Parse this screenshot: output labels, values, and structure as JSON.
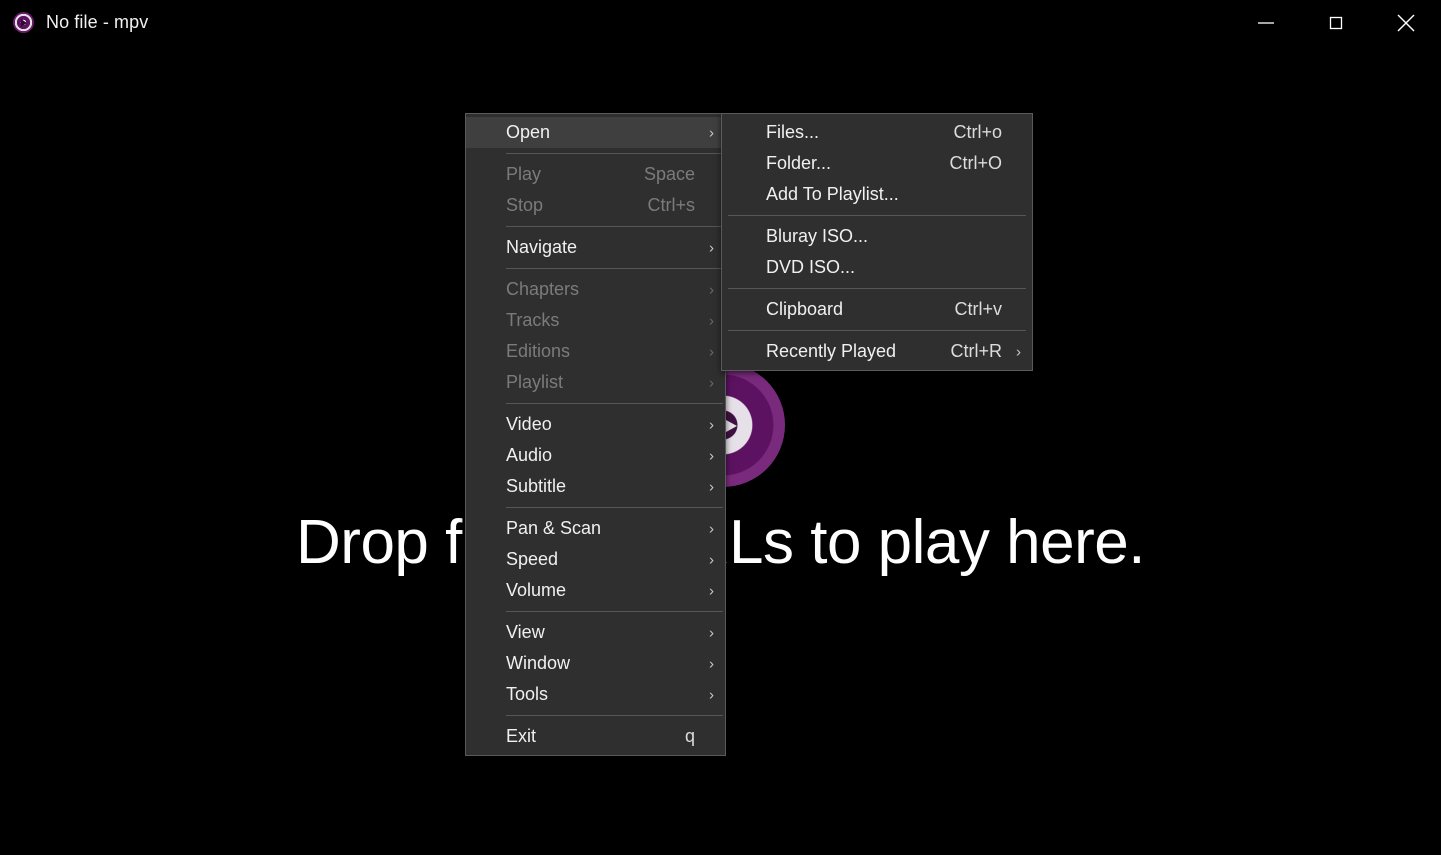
{
  "window": {
    "title": "No file - mpv",
    "icon": "mpv-logo-icon",
    "controls": {
      "minimize": "minimize-button",
      "maximize": "maximize-button",
      "close": "close-button"
    }
  },
  "splash": {
    "text": "Drop files or URLs to play here.",
    "logo": "mpv-logo"
  },
  "colors": {
    "window_background": "#000000",
    "menu_background": "#2f2f2f",
    "menu_border": "#5a5a5a",
    "menu_highlight": "#3f3f3f",
    "menu_text": "#f0f0f0",
    "menu_text_disabled": "#7b7b7b",
    "separator": "#565656",
    "logo_purple": "#6d1f70"
  },
  "context_menu": {
    "name": "mpv-context-menu",
    "items": [
      {
        "label": "Open",
        "accel": "",
        "arrow": true,
        "disabled": false,
        "highlight": true,
        "sep_after": true
      },
      {
        "label": "Play",
        "accel": "Space",
        "arrow": false,
        "disabled": true,
        "highlight": false,
        "sep_after": false
      },
      {
        "label": "Stop",
        "accel": "Ctrl+s",
        "arrow": false,
        "disabled": true,
        "highlight": false,
        "sep_after": true
      },
      {
        "label": "Navigate",
        "accel": "",
        "arrow": true,
        "disabled": false,
        "highlight": false,
        "sep_after": true
      },
      {
        "label": "Chapters",
        "accel": "",
        "arrow": true,
        "disabled": true,
        "highlight": false,
        "sep_after": false
      },
      {
        "label": "Tracks",
        "accel": "",
        "arrow": true,
        "disabled": true,
        "highlight": false,
        "sep_after": false
      },
      {
        "label": "Editions",
        "accel": "",
        "arrow": true,
        "disabled": true,
        "highlight": false,
        "sep_after": false
      },
      {
        "label": "Playlist",
        "accel": "",
        "arrow": true,
        "disabled": true,
        "highlight": false,
        "sep_after": true
      },
      {
        "label": "Video",
        "accel": "",
        "arrow": true,
        "disabled": false,
        "highlight": false,
        "sep_after": false
      },
      {
        "label": "Audio",
        "accel": "",
        "arrow": true,
        "disabled": false,
        "highlight": false,
        "sep_after": false
      },
      {
        "label": "Subtitle",
        "accel": "",
        "arrow": true,
        "disabled": false,
        "highlight": false,
        "sep_after": true
      },
      {
        "label": "Pan & Scan",
        "accel": "",
        "arrow": true,
        "disabled": false,
        "highlight": false,
        "sep_after": false
      },
      {
        "label": "Speed",
        "accel": "",
        "arrow": true,
        "disabled": false,
        "highlight": false,
        "sep_after": false
      },
      {
        "label": "Volume",
        "accel": "",
        "arrow": true,
        "disabled": false,
        "highlight": false,
        "sep_after": true
      },
      {
        "label": "View",
        "accel": "",
        "arrow": true,
        "disabled": false,
        "highlight": false,
        "sep_after": false
      },
      {
        "label": "Window",
        "accel": "",
        "arrow": true,
        "disabled": false,
        "highlight": false,
        "sep_after": false
      },
      {
        "label": "Tools",
        "accel": "",
        "arrow": true,
        "disabled": false,
        "highlight": false,
        "sep_after": true
      },
      {
        "label": "Exit",
        "accel": "q",
        "arrow": false,
        "disabled": false,
        "highlight": false,
        "sep_after": false
      }
    ]
  },
  "open_submenu": {
    "name": "open-submenu",
    "items": [
      {
        "label": "Files...",
        "accel": "Ctrl+o",
        "arrow": false,
        "disabled": false,
        "sep_after": false
      },
      {
        "label": "Folder...",
        "accel": "Ctrl+O",
        "arrow": false,
        "disabled": false,
        "sep_after": false
      },
      {
        "label": "Add To Playlist...",
        "accel": "",
        "arrow": false,
        "disabled": false,
        "sep_after": true
      },
      {
        "label": "Bluray ISO...",
        "accel": "",
        "arrow": false,
        "disabled": false,
        "sep_after": false
      },
      {
        "label": "DVD ISO...",
        "accel": "",
        "arrow": false,
        "disabled": false,
        "sep_after": true
      },
      {
        "label": "Clipboard",
        "accel": "Ctrl+v",
        "arrow": false,
        "disabled": false,
        "sep_after": true
      },
      {
        "label": "Recently Played",
        "accel": "Ctrl+R",
        "arrow": true,
        "disabled": false,
        "sep_after": false
      }
    ]
  }
}
